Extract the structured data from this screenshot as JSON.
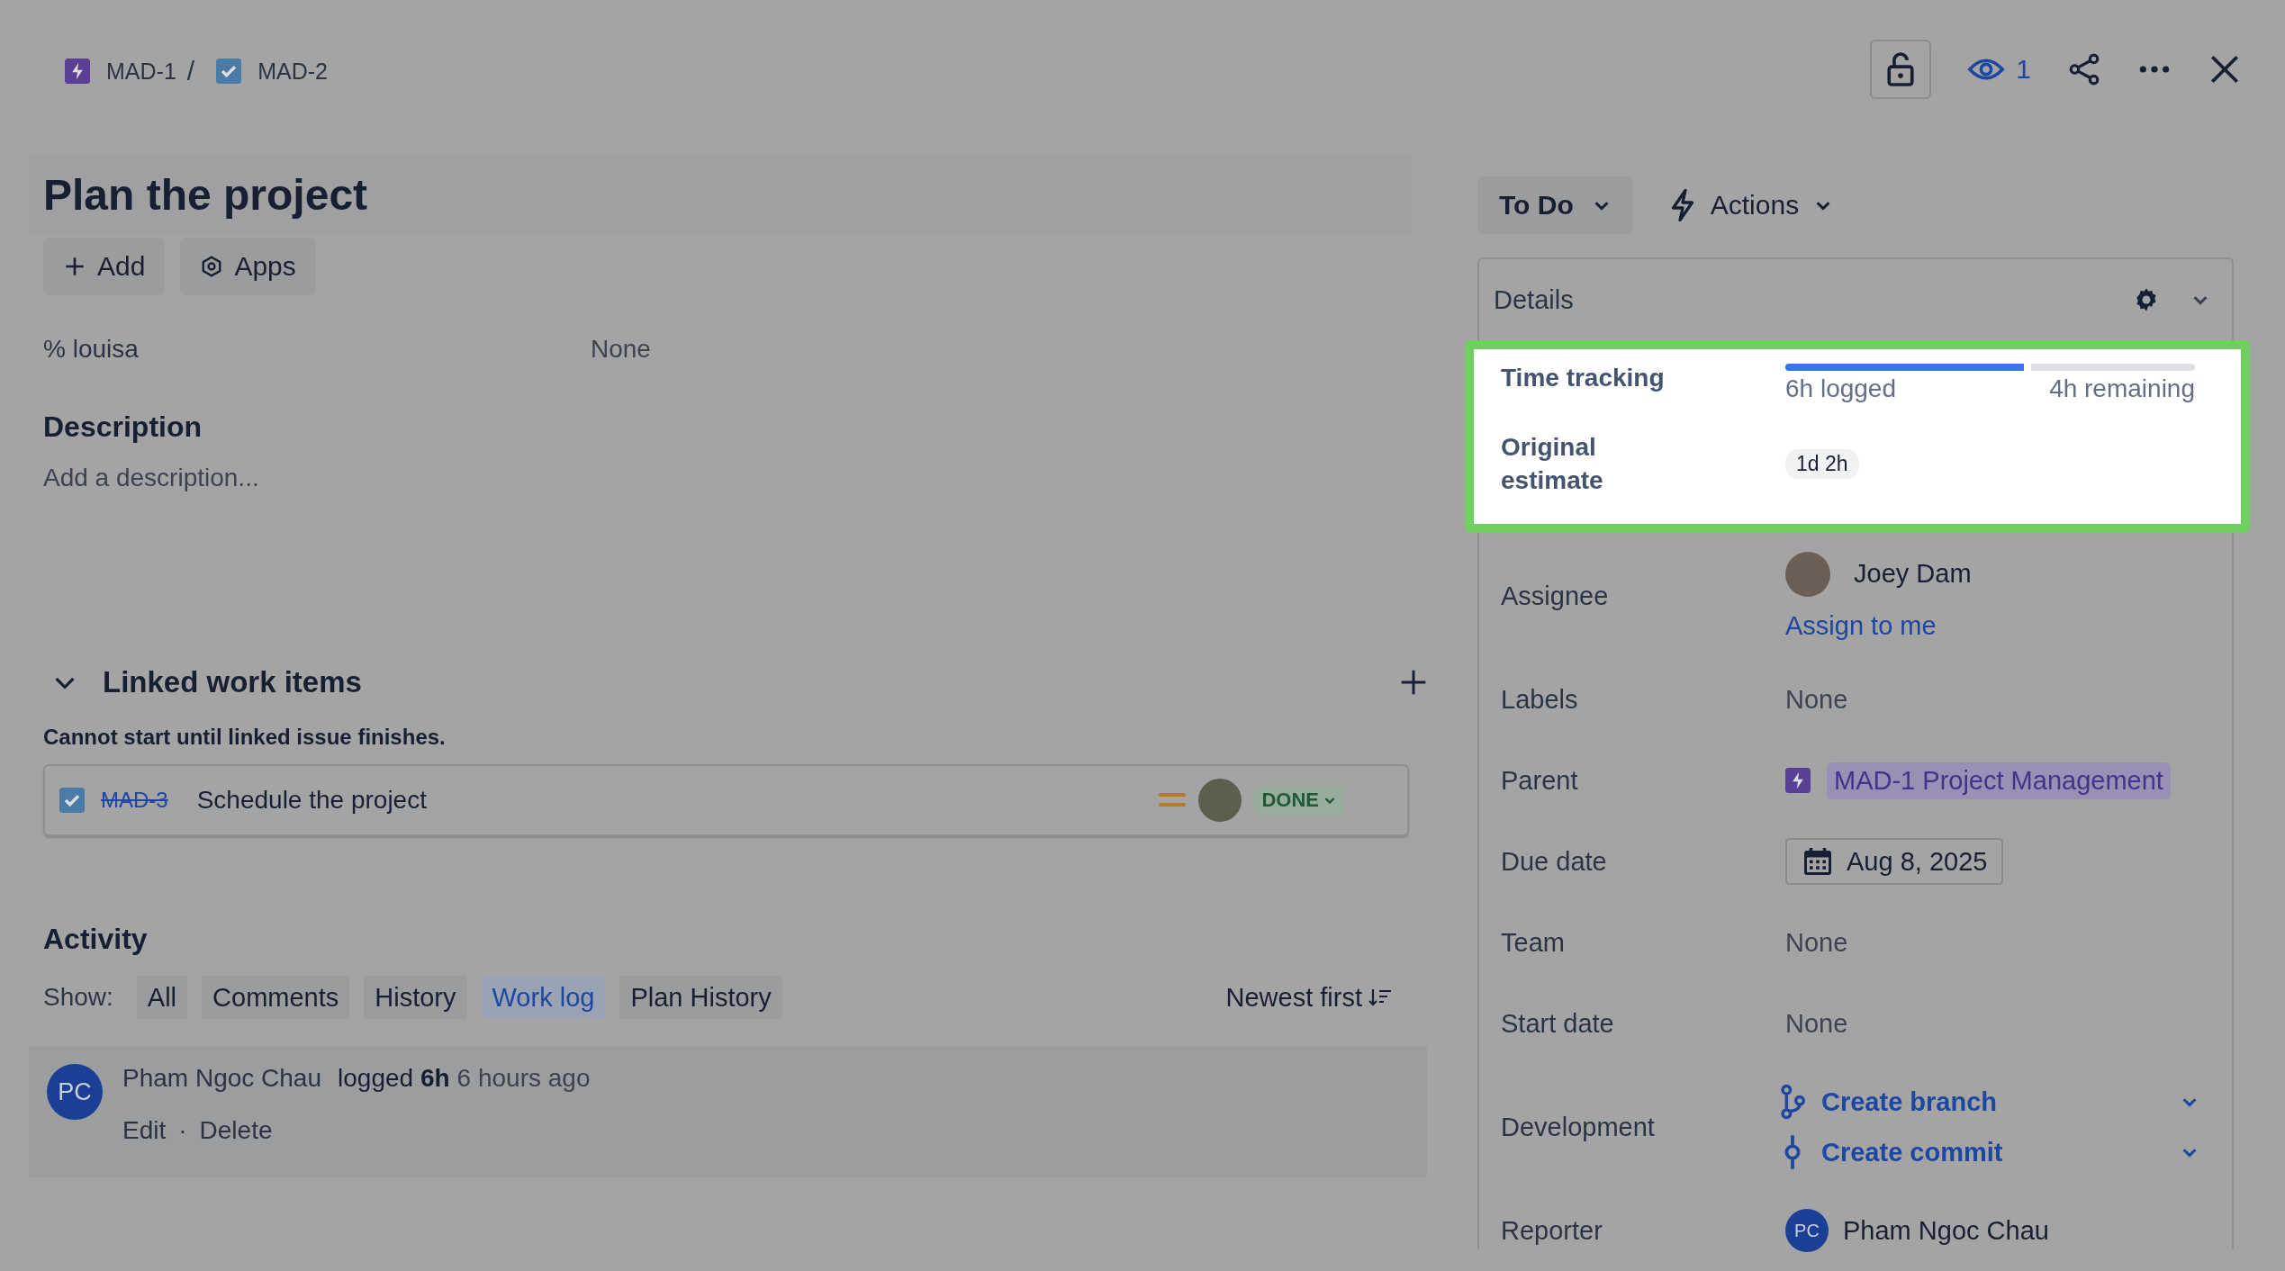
{
  "breadcrumbs": [
    {
      "key": "MAD-1",
      "kind": "epic"
    },
    {
      "key": "MAD-2",
      "kind": "task"
    }
  ],
  "breadcrumb_separator": "/",
  "header": {
    "watchers": "1"
  },
  "title": "Plan the project",
  "toolbar": [
    {
      "label": "Add",
      "kind": "add"
    },
    {
      "label": "Apps",
      "kind": "apps"
    }
  ],
  "custom_fields": [
    {
      "label": "% louisa",
      "value": "None"
    }
  ],
  "description": {
    "heading": "Description",
    "prompt": "Add a description..."
  },
  "linked_items": {
    "heading": "Linked work items",
    "expanded": true,
    "relation": "Cannot start until linked issue finishes.",
    "items": [
      {
        "key": "MAD-3",
        "summary": "Schedule the project",
        "resolved": true,
        "status": "DONE"
      }
    ]
  },
  "activity": {
    "heading": "Activity",
    "show_label": "Show:",
    "filters": [
      {
        "label": "All",
        "selected": false
      },
      {
        "label": "Comments",
        "selected": false
      },
      {
        "label": "History",
        "selected": false
      },
      {
        "label": "Work log",
        "selected": true
      },
      {
        "label": "Plan History",
        "selected": false
      }
    ],
    "sort": "Newest first",
    "entries": [
      {
        "initials": "PC",
        "author": "Pham Ngoc Chau",
        "action": "logged **6h**",
        "time": "6 hours ago",
        "actions": [
          "Edit",
          "Delete"
        ],
        "separator": "·"
      }
    ]
  },
  "status": "To Do",
  "actions_label": "Actions",
  "details": {
    "heading": "Details",
    "highlighted": true,
    "time_tracking": {
      "label": "Time tracking",
      "level": 0.6,
      "logged": "6h logged",
      "remaining": "4h remaining"
    },
    "original_estimate": {
      "label": "Original estimate",
      "value": "1d 2h"
    },
    "fields": [
      {
        "kind": "assignee",
        "label": "Assignee",
        "name": "Joey Dam",
        "link": "Assign to me"
      },
      {
        "kind": "text",
        "label": "Labels",
        "value": "None"
      },
      {
        "kind": "parent",
        "label": "Parent",
        "value": "MAD-1 Project Management"
      },
      {
        "kind": "date",
        "label": "Due date",
        "value": "Aug 8, 2025"
      },
      {
        "kind": "text",
        "label": "Team",
        "value": "None"
      },
      {
        "kind": "text",
        "label": "Start date",
        "value": "None"
      },
      {
        "kind": "development",
        "label": "Development",
        "links": [
          {
            "kind": "branch",
            "label": "Create branch"
          },
          {
            "kind": "commit",
            "label": "Create commit"
          }
        ]
      },
      {
        "kind": "reporter",
        "label": "Reporter",
        "initials": "PC",
        "name": "Pham Ngoc Chau"
      }
    ]
  }
}
